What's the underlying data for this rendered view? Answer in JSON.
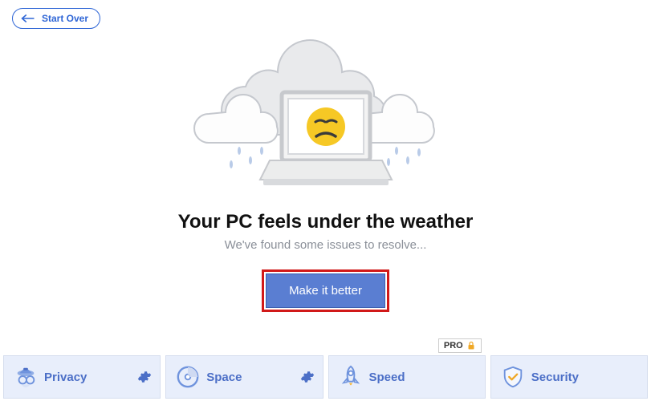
{
  "header": {
    "start_over": "Start Over"
  },
  "hero": {
    "headline": "Your PC feels under the weather",
    "subline": "We've found some issues to resolve...",
    "cta": "Make it better"
  },
  "cards": [
    {
      "label": "Privacy",
      "icon": "spy-icon",
      "gear": true,
      "pro": false
    },
    {
      "label": "Space",
      "icon": "disk-icon",
      "gear": true,
      "pro": false
    },
    {
      "label": "Speed",
      "icon": "rocket-icon",
      "gear": false,
      "pro": true,
      "pro_label": "PRO"
    },
    {
      "label": "Security",
      "icon": "shield-icon",
      "gear": false,
      "pro": false
    }
  ],
  "colors": {
    "accent": "#5a7ed2",
    "accent_dark": "#2f66d6",
    "card_bg": "#e8eefb"
  }
}
